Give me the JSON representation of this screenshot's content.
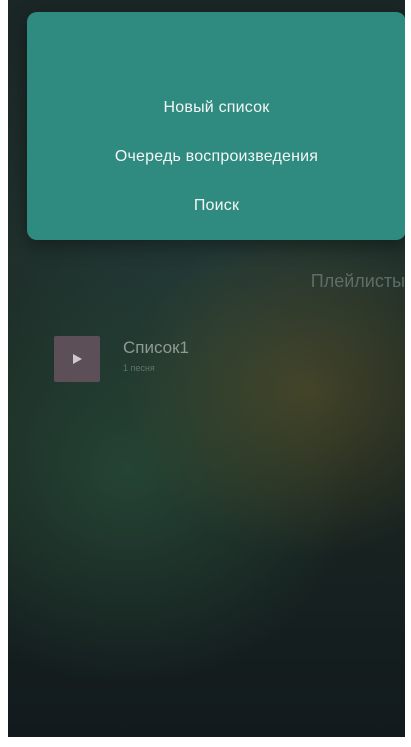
{
  "menu": {
    "items": [
      {
        "label": "Новый список"
      },
      {
        "label": "Очередь воспроизведения"
      },
      {
        "label": "Поиск"
      }
    ]
  },
  "playlists": {
    "section_title": "Плейлисты",
    "items": [
      {
        "title": "Список1",
        "subtitle": "1 песня",
        "icon": "play-icon"
      }
    ]
  },
  "colors": {
    "menu_background": "#2f8b80",
    "thumbnail": "#5d4f58"
  }
}
